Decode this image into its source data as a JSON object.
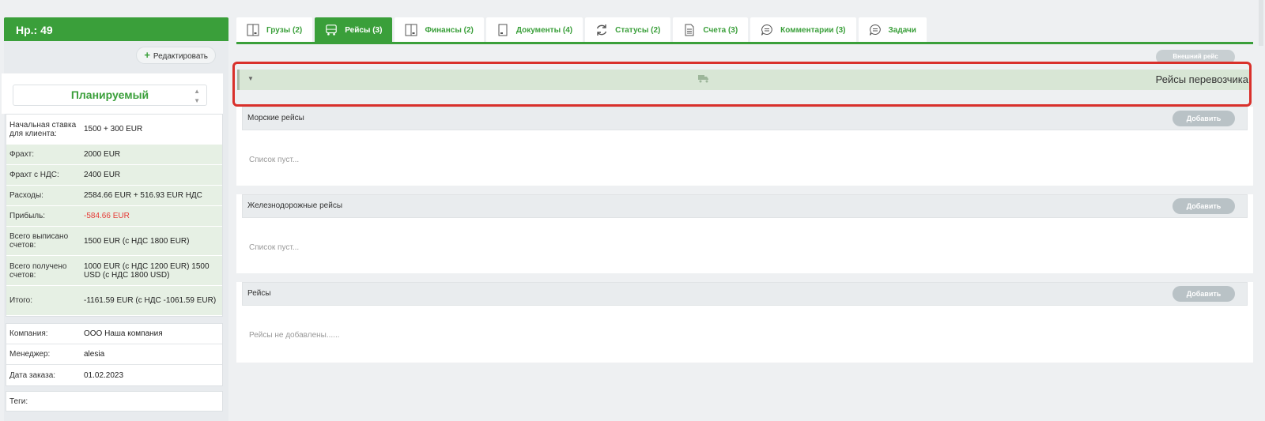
{
  "order": {
    "title": "Нр.: 49"
  },
  "edit_button": {
    "label": "Редактировать"
  },
  "status": {
    "value": "Планируемый"
  },
  "finance": [
    {
      "key": "Начальная ставка для клиента:",
      "value": "1500 + 300 EUR",
      "green": false,
      "h": 38
    },
    {
      "key": "Фрахт:",
      "value": "2000 EUR",
      "green": true,
      "h": 26
    },
    {
      "key": "Фрахт с НДС:",
      "value": "2400 EUR",
      "green": true,
      "h": 26
    },
    {
      "key": "Расходы:",
      "value": "2584.66 EUR + 516.93 EUR НДС",
      "green": true,
      "h": 26
    },
    {
      "key": "Прибыль:",
      "value": "-584.66 EUR",
      "green": true,
      "h": 26,
      "neg": true
    },
    {
      "key": "Всего выписано счетов:",
      "value": "1500 EUR (с НДС 1800 EUR)",
      "green": true,
      "h": 37
    },
    {
      "key": "Всего получено счетов:",
      "value": "1000 EUR (с НДС 1200 EUR) 1500 USD (с НДС 1800 USD)",
      "green": true,
      "h": 38
    },
    {
      "key": "Итого:",
      "value": "-1161.59 EUR (с НДС -1061.59 EUR)",
      "green": true,
      "h": 38
    }
  ],
  "details": [
    {
      "key": "Компания:",
      "value": "ООО Наша компания"
    },
    {
      "key": "Менеджер:",
      "value": "alesia"
    },
    {
      "key": "Дата заказа:",
      "value": "01.02.2023"
    }
  ],
  "tags": {
    "label": "Теги:"
  },
  "tabs": [
    {
      "label": "Грузы (2)",
      "icon": "cargo-icon",
      "active": false
    },
    {
      "label": "Рейсы (3)",
      "icon": "bus-icon",
      "active": true
    },
    {
      "label": "Финансы (2)",
      "icon": "finance-icon",
      "active": false
    },
    {
      "label": "Документы (4)",
      "icon": "document-icon",
      "active": false
    },
    {
      "label": "Статусы (2)",
      "icon": "refresh-icon",
      "active": false
    },
    {
      "label": "Счета (3)",
      "icon": "invoice-icon",
      "active": false
    },
    {
      "label": "Комментарии (3)",
      "icon": "comment-icon",
      "active": false
    },
    {
      "label": "Задачи",
      "icon": "task-icon",
      "active": false
    }
  ],
  "external_trip_button": {
    "label": "Внешний рейс"
  },
  "carrier_bar": {
    "title": "Рейсы перевозчика"
  },
  "sections": [
    {
      "title": "Морские рейсы",
      "add_label": "Добавить",
      "empty": "Список пуст..."
    },
    {
      "title": "Железнодорожные рейсы",
      "add_label": "Добавить",
      "empty": "Список пуст..."
    },
    {
      "title": "Рейсы",
      "add_label": "Добавить",
      "empty": "Рейсы не добавлены......"
    }
  ],
  "colors": {
    "accent": "#3a9f3a",
    "highlight": "#d9302b",
    "negative": "#e53935"
  }
}
